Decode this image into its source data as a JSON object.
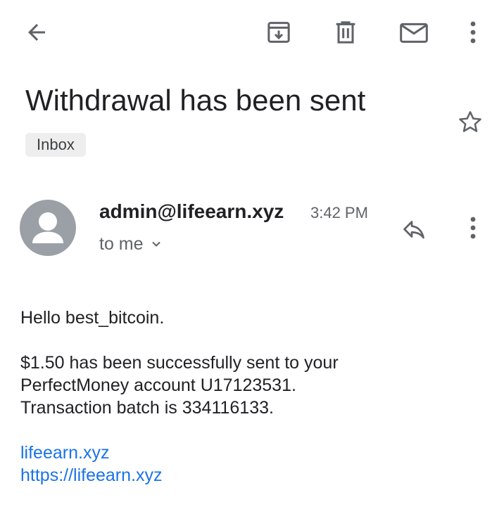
{
  "toolbar": {
    "back_icon": "arrow-left-icon",
    "archive_icon": "archive-icon",
    "delete_icon": "trash-icon",
    "mark_unread_icon": "envelope-icon",
    "more_icon": "more-vert-icon"
  },
  "email": {
    "subject": "Withdrawal has been sent",
    "label": "Inbox",
    "star_icon": "star-outline-icon",
    "sender": "admin@lifeearn.xyz",
    "time": "3:42 PM",
    "recipient": "to me",
    "reply_icon": "reply-icon",
    "more_icon": "more-vert-icon",
    "body": {
      "greeting": "Hello best_bitcoin.",
      "line1": "$1.50 has been successfully sent to your",
      "line2": "PerfectMoney account U17123531.",
      "line3": "Transaction batch is 334116133.",
      "link1": "lifeearn.xyz",
      "link2": "https://lifeearn.xyz"
    }
  },
  "colors": {
    "icon": "#5f6368",
    "link": "#1a73e8",
    "avatar_bg": "#9aa0a6",
    "chip_bg": "#eeeeee"
  }
}
